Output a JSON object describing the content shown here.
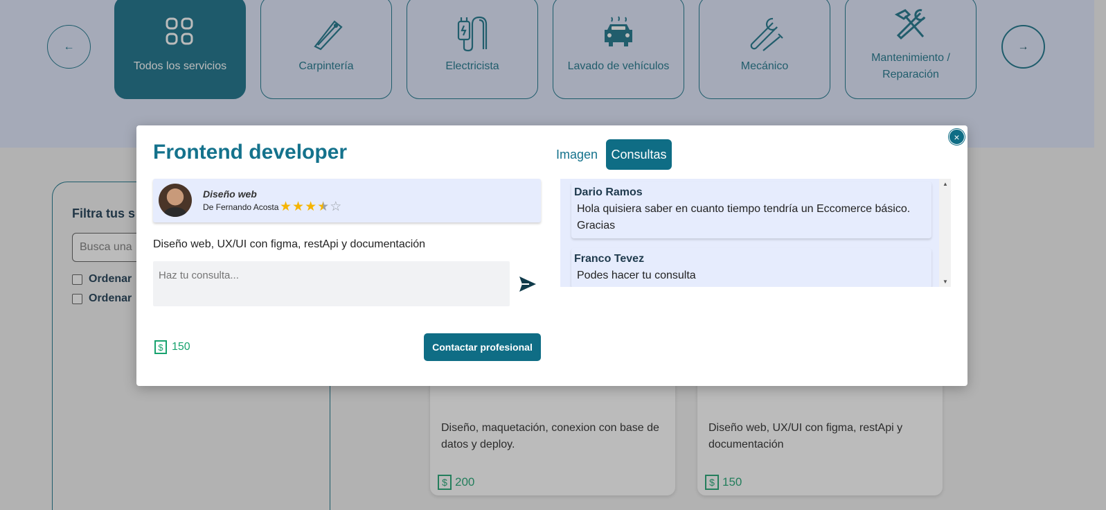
{
  "categories": {
    "items": [
      {
        "label": "Todos los servicios",
        "icon": "grid-icon"
      },
      {
        "label": "Carpintería",
        "icon": "saw-icon"
      },
      {
        "label": "Electricista",
        "icon": "plug-icon"
      },
      {
        "label": "Lavado de vehículos",
        "icon": "car-wash-icon"
      },
      {
        "label": "Mecánico",
        "icon": "wrench-screwdriver-icon"
      },
      {
        "label": "Mantenimiento / Reparación",
        "icon": "hammer-wrench-icon"
      }
    ],
    "prev_arrow": "←",
    "next_arrow": "→"
  },
  "filter": {
    "title": "Filtra tus s",
    "search_placeholder": "Busca una",
    "options": [
      "Ordenar",
      "Ordenar"
    ]
  },
  "background_cards": [
    {
      "description": "Diseño, maquetación, conexion con base de datos y deploy.",
      "price": "200"
    },
    {
      "description": "Diseño web, UX/UI con figma, restApi y documentación",
      "price": "150"
    }
  ],
  "modal": {
    "title": "Frontend developer",
    "close_label": "×",
    "author": {
      "category": "Diseño web",
      "byline": "De Fernando Acosta",
      "rating": 3.5,
      "max_rating": 5
    },
    "description": "Diseño web, UX/UI con figma, restApi y documentación",
    "query_placeholder": "Haz tu consulta...",
    "price": "150",
    "contact_button": "Contactar profesional",
    "tabs": [
      {
        "label": "Imagen",
        "active": false
      },
      {
        "label": "Consultas",
        "active": true
      }
    ],
    "consultations": [
      {
        "name": "Dario Ramos",
        "message": "Hola quisiera saber en cuanto tiempo tendría un Eccomerce básico. Gracias"
      },
      {
        "name": "Franco Tevez",
        "message": "Podes hacer tu consulta"
      }
    ]
  },
  "colors": {
    "primary": "#0f6d85",
    "band": "#dde5fb",
    "price": "#17a26e",
    "star": "#f5b400"
  }
}
